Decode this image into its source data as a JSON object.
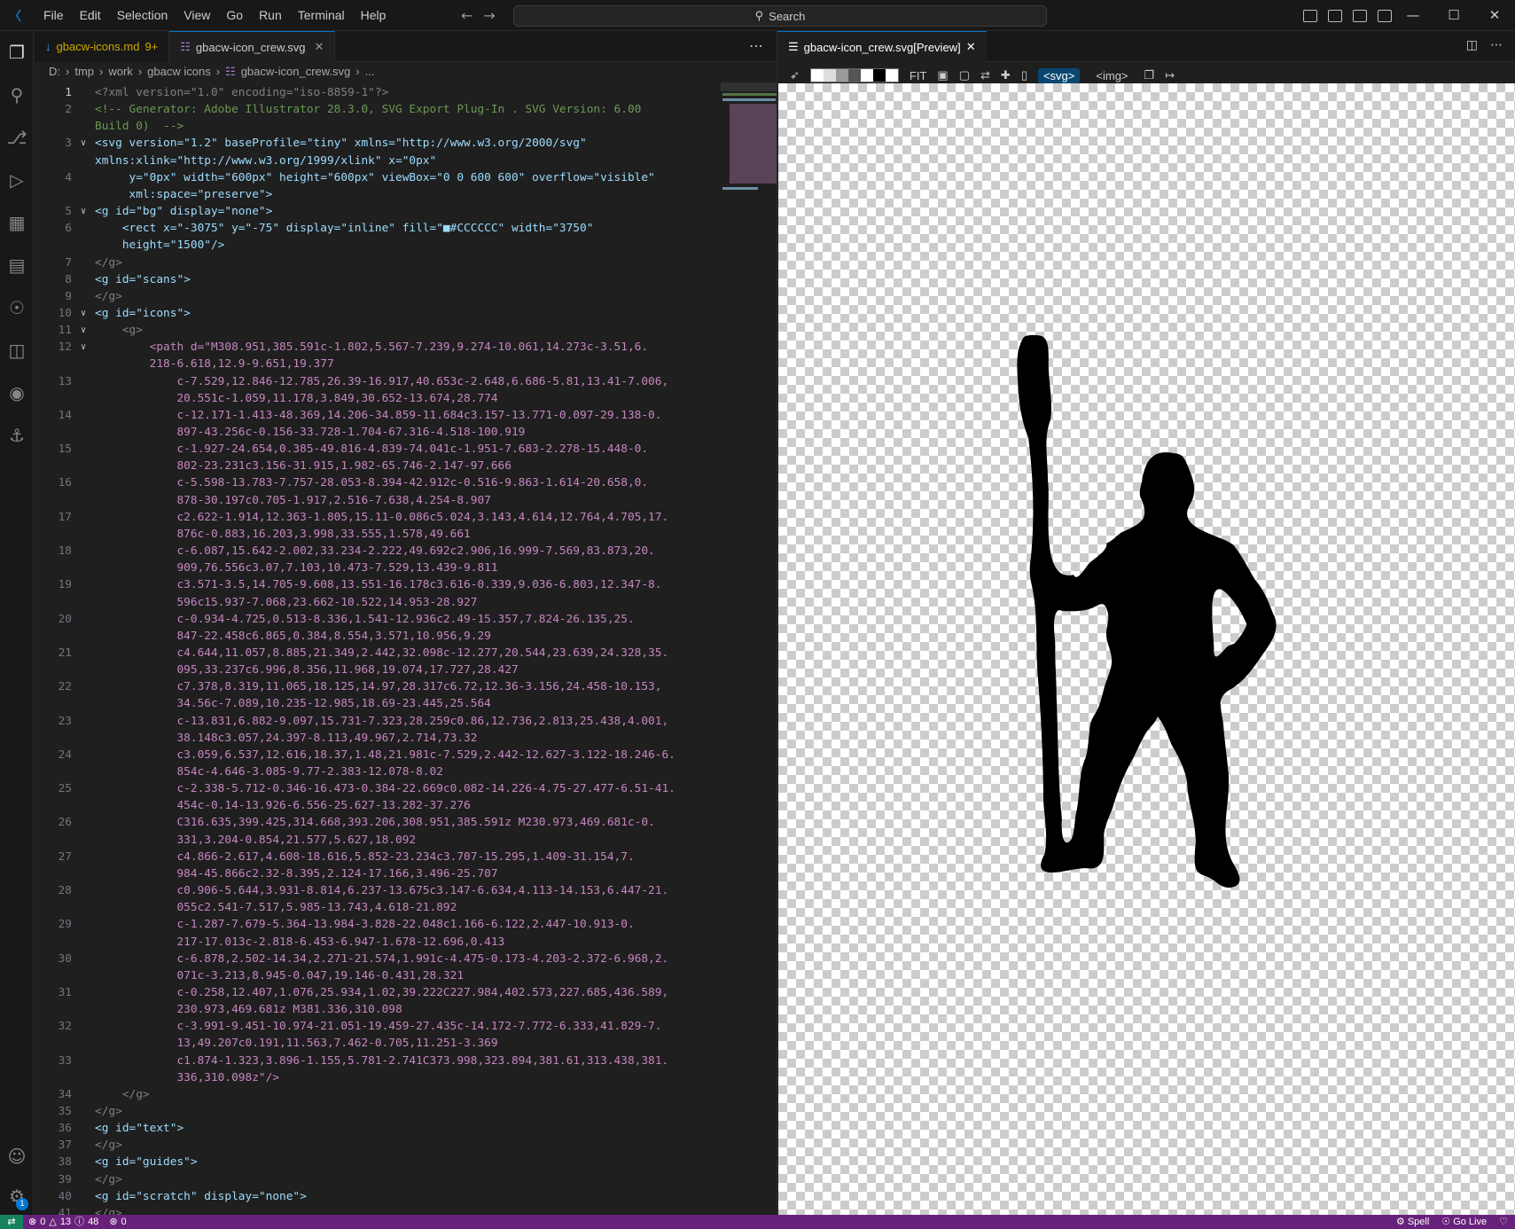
{
  "menu": [
    "File",
    "Edit",
    "Selection",
    "View",
    "Go",
    "Run",
    "Terminal",
    "Help"
  ],
  "search_placeholder": "Search",
  "editor": {
    "tabs": [
      {
        "label": "gbacw-icons.md",
        "badge": "9+",
        "icon": "markdown-icon",
        "active": false
      },
      {
        "label": "gbacw-icon_crew.svg",
        "icon": "svg-file-icon",
        "active": true
      }
    ],
    "breadcrumb": [
      "D:",
      "tmp",
      "work",
      "gbacw icons",
      "gbacw-icon_crew.svg",
      "..."
    ],
    "lines": [
      {
        "n": "1",
        "fold": "",
        "text": "<?xml version=\"1.0\" encoding=\"iso-8859-1\"?>",
        "color": "#808080"
      },
      {
        "n": "2",
        "fold": "",
        "text": "<!-- Generator: Adobe Illustrator 28.3.0, SVG Export Plug-In . SVG Version: 6.00",
        "color": "#6a9955"
      },
      {
        "n": "",
        "fold": "",
        "text": "Build 0)  -->",
        "color": "#6a9955"
      },
      {
        "n": "3",
        "fold": "v",
        "text": "<svg version=\"1.2\" baseProfile=\"tiny\" xmlns=\"http://www.w3.org/2000/svg\"",
        "color": "#9cdcfe"
      },
      {
        "n": "",
        "fold": "",
        "text": "xmlns:xlink=\"http://www.w3.org/1999/xlink\" x=\"0px\"",
        "color": "#9cdcfe"
      },
      {
        "n": "4",
        "fold": "",
        "text": "     y=\"0px\" width=\"600px\" height=\"600px\" viewBox=\"0 0 600 600\" overflow=\"visible\"",
        "color": "#9cdcfe"
      },
      {
        "n": "",
        "fold": "",
        "text": "     xml:space=\"preserve\">",
        "color": "#9cdcfe"
      },
      {
        "n": "5",
        "fold": "v",
        "text": "<g id=\"bg\" display=\"none\">",
        "color": "#9cdcfe"
      },
      {
        "n": "6",
        "fold": "",
        "text": "    <rect x=\"-3075\" y=\"-75\" display=\"inline\" fill=\"■#CCCCCC\" width=\"3750\"",
        "color": "#9cdcfe"
      },
      {
        "n": "",
        "fold": "",
        "text": "    height=\"1500\"/>",
        "color": "#9cdcfe"
      },
      {
        "n": "7",
        "fold": "",
        "text": "</g>",
        "color": "#808080"
      },
      {
        "n": "8",
        "fold": "",
        "text": "<g id=\"scans\">",
        "color": "#9cdcfe"
      },
      {
        "n": "9",
        "fold": "",
        "text": "</g>",
        "color": "#808080"
      },
      {
        "n": "10",
        "fold": "v",
        "text": "<g id=\"icons\">",
        "color": "#9cdcfe"
      },
      {
        "n": "11",
        "fold": "v",
        "text": "    <g>",
        "color": "#808080"
      },
      {
        "n": "12",
        "fold": "v",
        "text": "        <path d=\"M308.951,385.591c-1.802,5.567-7.239,9.274-10.061,14.273c-3.51,6.",
        "color": "#c586c0"
      },
      {
        "n": "",
        "fold": "",
        "text": "        218-6.618,12.9-9.651,19.377",
        "color": "#c586c0"
      },
      {
        "n": "13",
        "fold": "",
        "text": "            c-7.529,12.846-12.785,26.39-16.917,40.653c-2.648,6.686-5.81,13.41-7.006,",
        "color": "#c586c0"
      },
      {
        "n": "",
        "fold": "",
        "text": "            20.551c-1.059,11.178,3.849,30.652-13.674,28.774",
        "color": "#c586c0"
      },
      {
        "n": "14",
        "fold": "",
        "text": "            c-12.171-1.413-48.369,14.206-34.859-11.684c3.157-13.771-0.097-29.138-0.",
        "color": "#c586c0"
      },
      {
        "n": "",
        "fold": "",
        "text": "            897-43.256c-0.156-33.728-1.704-67.316-4.518-100.919",
        "color": "#c586c0"
      },
      {
        "n": "15",
        "fold": "",
        "text": "            c-1.927-24.654,0.385-49.816-4.839-74.041c-1.951-7.683-2.278-15.448-0.",
        "color": "#c586c0"
      },
      {
        "n": "",
        "fold": "",
        "text": "            802-23.231c3.156-31.915,1.982-65.746-2.147-97.666",
        "color": "#c586c0"
      },
      {
        "n": "16",
        "fold": "",
        "text": "            c-5.598-13.783-7.757-28.053-8.394-42.912c-0.516-9.863-1.614-20.658,0.",
        "color": "#c586c0"
      },
      {
        "n": "",
        "fold": "",
        "text": "            878-30.197c0.705-1.917,2.516-7.638,4.254-8.907",
        "color": "#c586c0"
      },
      {
        "n": "17",
        "fold": "",
        "text": "            c2.622-1.914,12.363-1.805,15.11-0.086c5.024,3.143,4.614,12.764,4.705,17.",
        "color": "#c586c0"
      },
      {
        "n": "",
        "fold": "",
        "text": "            876c-0.883,16.203,3.998,33.555,1.578,49.661",
        "color": "#c586c0"
      },
      {
        "n": "18",
        "fold": "",
        "text": "            c-6.087,15.642-2.002,33.234-2.222,49.692c2.906,16.999-7.569,83.873,20.",
        "color": "#c586c0"
      },
      {
        "n": "",
        "fold": "",
        "text": "            909,76.556c3.07,7.103,10.473-7.529,13.439-9.811",
        "color": "#c586c0"
      },
      {
        "n": "19",
        "fold": "",
        "text": "            c3.571-3.5,14.705-9.608,13.551-16.178c3.616-0.339,9.036-6.803,12.347-8.",
        "color": "#c586c0"
      },
      {
        "n": "",
        "fold": "",
        "text": "            596c15.937-7.068,23.662-10.522,14.953-28.927",
        "color": "#c586c0"
      },
      {
        "n": "20",
        "fold": "",
        "text": "            c-0.934-4.725,0.513-8.336,1.541-12.936c2.49-15.357,7.824-26.135,25.",
        "color": "#c586c0"
      },
      {
        "n": "",
        "fold": "",
        "text": "            847-22.458c6.865,0.384,8.554,3.571,10.956,9.29",
        "color": "#c586c0"
      },
      {
        "n": "21",
        "fold": "",
        "text": "            c4.644,11.057,8.885,21.349,2.442,32.098c-12.277,20.544,23.639,24.328,35.",
        "color": "#c586c0"
      },
      {
        "n": "",
        "fold": "",
        "text": "            095,33.237c6.996,8.356,11.968,19.074,17.727,28.427",
        "color": "#c586c0"
      },
      {
        "n": "22",
        "fold": "",
        "text": "            c7.378,8.319,11.065,18.125,14.97,28.317c6.72,12.36-3.156,24.458-10.153,",
        "color": "#c586c0"
      },
      {
        "n": "",
        "fold": "",
        "text": "            34.56c-7.089,10.235-12.985,18.69-23.445,25.564",
        "color": "#c586c0"
      },
      {
        "n": "23",
        "fold": "",
        "text": "            c-13.831,6.882-9.097,15.731-7.323,28.259c0.86,12.736,2.813,25.438,4.001,",
        "color": "#c586c0"
      },
      {
        "n": "",
        "fold": "",
        "text": "            38.148c3.057,24.397-8.113,49.967,2.714,73.32",
        "color": "#c586c0"
      },
      {
        "n": "24",
        "fold": "",
        "text": "            c3.059,6.537,12.616,18.37,1.48,21.981c-7.529,2.442-12.627-3.122-18.246-6.",
        "color": "#c586c0"
      },
      {
        "n": "",
        "fold": "",
        "text": "            854c-4.646-3.085-9.77-2.383-12.078-8.02",
        "color": "#c586c0"
      },
      {
        "n": "25",
        "fold": "",
        "text": "            c-2.338-5.712-0.346-16.473-0.384-22.669c0.082-14.226-4.75-27.477-6.51-41.",
        "color": "#c586c0"
      },
      {
        "n": "",
        "fold": "",
        "text": "            454c-0.14-13.926-6.556-25.627-13.282-37.276",
        "color": "#c586c0"
      },
      {
        "n": "26",
        "fold": "",
        "text": "            C316.635,399.425,314.668,393.206,308.951,385.591z M230.973,469.681c-0.",
        "color": "#c586c0"
      },
      {
        "n": "",
        "fold": "",
        "text": "            331,3.204-0.854,21.577,5.627,18.092",
        "color": "#c586c0"
      },
      {
        "n": "27",
        "fold": "",
        "text": "            c4.866-2.617,4.608-18.616,5.852-23.234c3.707-15.295,1.409-31.154,7.",
        "color": "#c586c0"
      },
      {
        "n": "",
        "fold": "",
        "text": "            984-45.866c2.32-8.395,2.124-17.166,3.496-25.707",
        "color": "#c586c0"
      },
      {
        "n": "28",
        "fold": "",
        "text": "            c0.906-5.644,3.931-8.814,6.237-13.675c3.147-6.634,4.113-14.153,6.447-21.",
        "color": "#c586c0"
      },
      {
        "n": "",
        "fold": "",
        "text": "            055c2.541-7.517,5.985-13.743,4.618-21.892",
        "color": "#c586c0"
      },
      {
        "n": "29",
        "fold": "",
        "text": "            c-1.287-7.679-5.364-13.984-3.828-22.048c1.166-6.122,2.447-10.913-0.",
        "color": "#c586c0"
      },
      {
        "n": "",
        "fold": "",
        "text": "            217-17.013c-2.818-6.453-6.947-1.678-12.696,0.413",
        "color": "#c586c0"
      },
      {
        "n": "30",
        "fold": "",
        "text": "            c-6.878,2.502-14.34,2.271-21.574,1.991c-4.475-0.173-4.203-2.372-6.968,2.",
        "color": "#c586c0"
      },
      {
        "n": "",
        "fold": "",
        "text": "            071c-3.213,8.945-0.047,19.146-0.431,28.321",
        "color": "#c586c0"
      },
      {
        "n": "31",
        "fold": "",
        "text": "            c-0.258,12.407,1.076,25.934,1.02,39.222C227.984,402.573,227.685,436.589,",
        "color": "#c586c0"
      },
      {
        "n": "",
        "fold": "",
        "text": "            230.973,469.681z M381.336,310.098",
        "color": "#c586c0"
      },
      {
        "n": "32",
        "fold": "",
        "text": "            c-3.991-9.451-10.974-21.051-19.459-27.435c-14.172-7.772-6.333,41.829-7.",
        "color": "#c586c0"
      },
      {
        "n": "",
        "fold": "",
        "text": "            13,49.207c0.191,11.563,7.462-0.705,11.251-3.369",
        "color": "#c586c0"
      },
      {
        "n": "33",
        "fold": "",
        "text": "            c1.874-1.323,3.896-1.155,5.781-2.741C373.998,323.894,381.61,313.438,381.",
        "color": "#c586c0"
      },
      {
        "n": "",
        "fold": "",
        "text": "            336,310.098z\"/>",
        "color": "#c586c0"
      },
      {
        "n": "34",
        "fold": "",
        "text": "    </g>",
        "color": "#808080"
      },
      {
        "n": "35",
        "fold": "",
        "text": "</g>",
        "color": "#808080"
      },
      {
        "n": "36",
        "fold": "",
        "text": "<g id=\"text\">",
        "color": "#9cdcfe"
      },
      {
        "n": "37",
        "fold": "",
        "text": "</g>",
        "color": "#808080"
      },
      {
        "n": "38",
        "fold": "",
        "text": "<g id=\"guides\">",
        "color": "#9cdcfe"
      },
      {
        "n": "39",
        "fold": "",
        "text": "</g>",
        "color": "#808080"
      },
      {
        "n": "40",
        "fold": "",
        "text": "<g id=\"scratch\" display=\"none\">",
        "color": "#9cdcfe"
      },
      {
        "n": "41",
        "fold": "",
        "text": "</g>",
        "color": "#808080"
      }
    ]
  },
  "preview": {
    "tab_label": "gbacw-icon_crew.svg[Preview]",
    "toolbar": {
      "fit": "FIT",
      "svg_tag": "<svg>",
      "img_tag": "<img>"
    }
  },
  "statusbar": {
    "errors": "0",
    "warnings": "13",
    "info": "48",
    "ports": "0",
    "spell": "Spell",
    "golive": "Go Live"
  },
  "accounts_badge": "1",
  "colors": {
    "accent": "#0078d4",
    "statusbar": "#68217a",
    "remote": "#16825d"
  }
}
